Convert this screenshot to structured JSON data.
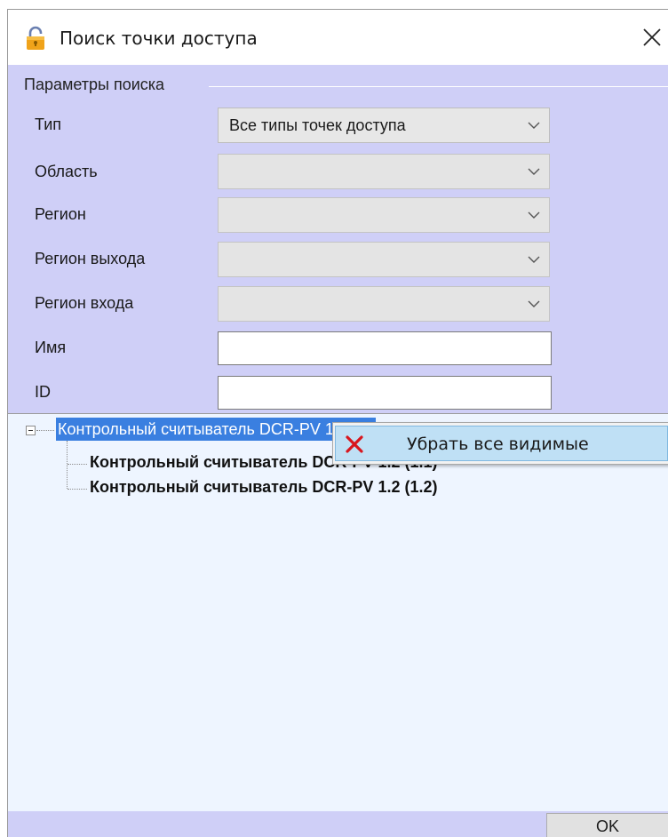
{
  "window": {
    "title": "Поиск точки доступа",
    "icon": "lock-open-icon",
    "close_glyph": "✕"
  },
  "search_params": {
    "group_label": "Параметры поиска",
    "fields": [
      {
        "label": "Тип",
        "type": "dropdown",
        "value": "Все типы точек доступа",
        "enabled": true
      },
      {
        "label": "Область",
        "type": "dropdown",
        "value": "",
        "enabled": false
      },
      {
        "label": "Регион",
        "type": "dropdown",
        "value": "",
        "enabled": false
      },
      {
        "label": "Регион выхода",
        "type": "dropdown",
        "value": "",
        "enabled": false
      },
      {
        "label": "Регион входа",
        "type": "dropdown",
        "value": "",
        "enabled": false
      },
      {
        "label": "Имя",
        "type": "text",
        "value": ""
      },
      {
        "label": "ID",
        "type": "text",
        "value": ""
      }
    ]
  },
  "tree": {
    "root": {
      "label": "Контрольный считыватель DCR-PV 1.2",
      "expanded": true,
      "selected": true
    },
    "children": [
      {
        "label": "Контрольный считыватель DCR-PV 1.2 (1.1)"
      },
      {
        "label": "Контрольный считыватель DCR-PV 1.2 (1.2)"
      }
    ]
  },
  "context_menu": {
    "items": [
      {
        "label": "Убрать все видимые",
        "icon": "red-x-icon",
        "highlighted": true
      }
    ]
  },
  "footer": {
    "ok_label": "OK"
  },
  "colors": {
    "panel_bg": "#cfcff7",
    "tree_bg": "#eef5ff",
    "selection": "#3a7fe0",
    "menu_highlight": "#bfe0f5",
    "icon_red": "#d8161e"
  }
}
